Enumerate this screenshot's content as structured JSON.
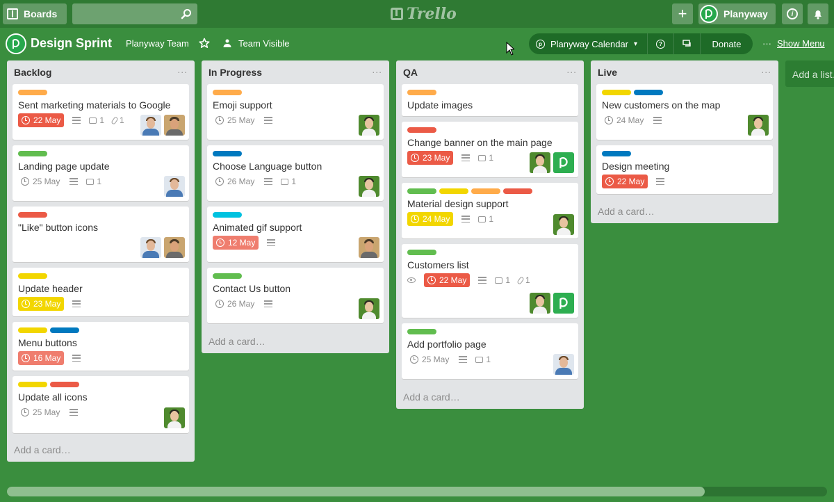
{
  "header": {
    "boards_label": "Boards",
    "search_placeholder": "",
    "logo_text": "Trello",
    "user_name": "Planyway"
  },
  "board": {
    "title": "Design Sprint",
    "team": "Planyway Team",
    "visibility": "Team Visible",
    "calendar_label": "Planyway Calendar",
    "donate_label": "Donate",
    "menu_label": "Show Menu"
  },
  "colors": {
    "orange": "#ffab4a",
    "red": "#eb5a46",
    "green": "#61bd4f",
    "yellow": "#f2d600",
    "blue": "#0079bf",
    "sky": "#00c2e0",
    "board_bg": "#3a8e3e"
  },
  "add_card_label": "Add a card…",
  "add_list_label": "Add a list…",
  "lists": [
    {
      "title": "Backlog",
      "cards": [
        {
          "title": "Sent marketing materials to Google",
          "due": "22 May",
          "comments": "1",
          "attachments": "1"
        },
        {
          "title": "Landing page update",
          "due": "25 May",
          "comments": "1"
        },
        {
          "title": "\"Like\" button icons"
        },
        {
          "title": "Update header",
          "due": "23 May"
        },
        {
          "title": "Menu buttons",
          "due": "16 May"
        },
        {
          "title": "Update all icons",
          "due": "25 May"
        }
      ]
    },
    {
      "title": "In Progress",
      "cards": [
        {
          "title": "Emoji support",
          "due": "25 May"
        },
        {
          "title": "Choose Language button",
          "due": "26 May",
          "comments": "1"
        },
        {
          "title": "Animated gif support",
          "due": "12 May"
        },
        {
          "title": "Contact Us button",
          "due": "26 May"
        }
      ]
    },
    {
      "title": "QA",
      "cards": [
        {
          "title": "Update images"
        },
        {
          "title": "Change banner on the main page",
          "due": "23 May",
          "comments": "1"
        },
        {
          "title": "Material design support",
          "due": "24 May",
          "comments": "1"
        },
        {
          "title": "Customers list",
          "due": "22 May",
          "comments": "1",
          "attachments": "1"
        },
        {
          "title": "Add portfolio page",
          "due": "25 May",
          "comments": "1"
        }
      ]
    },
    {
      "title": "Live",
      "cards": [
        {
          "title": "New customers on the map",
          "due": "24 May"
        },
        {
          "title": "Design meeting",
          "due": "22 May"
        }
      ]
    }
  ]
}
